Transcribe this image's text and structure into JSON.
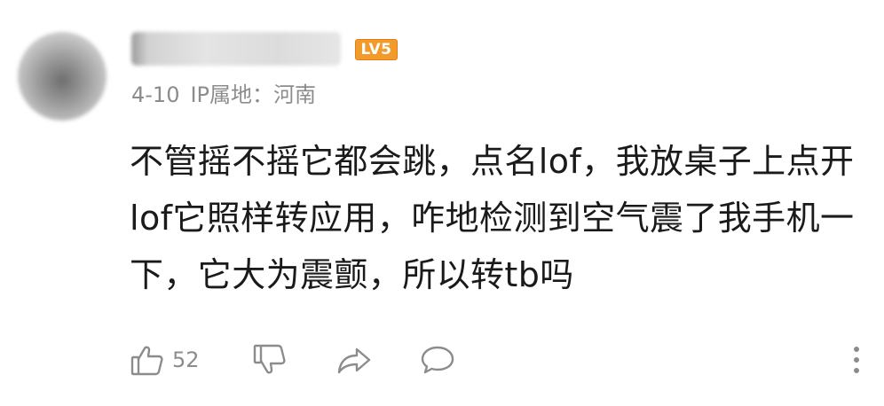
{
  "comment": {
    "author": {
      "avatar_icon": "blurred-avatar",
      "level_badge": "LV5"
    },
    "date": "4-10",
    "ip_location": "IP属地：河南",
    "text": "不管摇不摇它都会跳，点名lof，我放桌子上点开lof它照样转应用，咋地检测到空气震了我手机一下，它大为震颤，所以转tb吗"
  },
  "actions": {
    "like": {
      "icon": "thumbs-up-icon",
      "count": "52"
    },
    "dislike": {
      "icon": "thumbs-down-icon"
    },
    "share": {
      "icon": "share-arrow-icon"
    },
    "reply": {
      "icon": "comment-bubble-icon"
    },
    "more": {
      "icon": "more-vertical-icon"
    }
  },
  "colors": {
    "badge": "#f39a2c",
    "meta_text": "#8c8c8c",
    "body_text": "#1a1a1a",
    "icon_stroke": "#8c8c8c"
  }
}
